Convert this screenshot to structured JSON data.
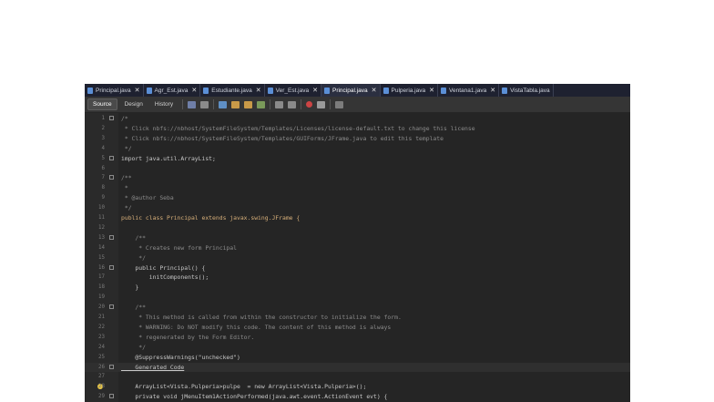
{
  "tabs": [
    {
      "label": "Principal.java",
      "active": false
    },
    {
      "label": "Agr_Est.java",
      "active": false
    },
    {
      "label": "Estudiante.java",
      "active": false
    },
    {
      "label": "Ver_Est.java",
      "active": false
    },
    {
      "label": "Principal.java",
      "active": true
    },
    {
      "label": "Pulperia.java",
      "active": false
    },
    {
      "label": "Ventana1.java",
      "active": false
    },
    {
      "label": "VistaTabla.java",
      "active": false
    }
  ],
  "toolbar": {
    "source": "Source",
    "design": "Design",
    "history": "History"
  },
  "lines": [
    {
      "n": "1",
      "text": "/*"
    },
    {
      "n": "2",
      "text": " * Click nbfs://nbhost/SystemFileSystem/Templates/Licenses/license-default.txt to change this license"
    },
    {
      "n": "3",
      "text": " * Click nbfs://nbhost/SystemFileSystem/Templates/GUIForms/JFrame.java to edit this template"
    },
    {
      "n": "4",
      "text": " */"
    },
    {
      "n": "5",
      "text": "import java.util.ArrayList;"
    },
    {
      "n": "6",
      "text": ""
    },
    {
      "n": "7",
      "text": "/**"
    },
    {
      "n": "8",
      "text": " *"
    },
    {
      "n": "9",
      "text": " * @author Seba"
    },
    {
      "n": "10",
      "text": " */"
    },
    {
      "n": "11",
      "text": "public class Principal extends javax.swing.JFrame {"
    },
    {
      "n": "12",
      "text": ""
    },
    {
      "n": "13",
      "text": "    /**"
    },
    {
      "n": "14",
      "text": "     * Creates new form Principal"
    },
    {
      "n": "15",
      "text": "     */"
    },
    {
      "n": "16",
      "text": "    public Principal() {"
    },
    {
      "n": "17",
      "text": "        initComponents();"
    },
    {
      "n": "18",
      "text": "    }"
    },
    {
      "n": "19",
      "text": ""
    },
    {
      "n": "20",
      "text": "    /**"
    },
    {
      "n": "21",
      "text": "     * This method is called from within the constructor to initialize the form."
    },
    {
      "n": "22",
      "text": "     * WARNING: Do NOT modify this code. The content of this method is always"
    },
    {
      "n": "23",
      "text": "     * regenerated by the Form Editor."
    },
    {
      "n": "24",
      "text": "     */"
    },
    {
      "n": "25",
      "text": "    @SuppressWarnings(\"unchecked\")"
    },
    {
      "n": "26",
      "text": "    Generated Code"
    },
    {
      "n": "27",
      "text": ""
    },
    {
      "n": "28",
      "text": "    ArrayList<Vista.Pulperia>pulpe  = new ArrayList<Vista.Pulperia>();"
    },
    {
      "n": "29",
      "text": "    private void jMenuItem1ActionPerformed(java.awt.event.ActionEvent evt) {"
    }
  ]
}
